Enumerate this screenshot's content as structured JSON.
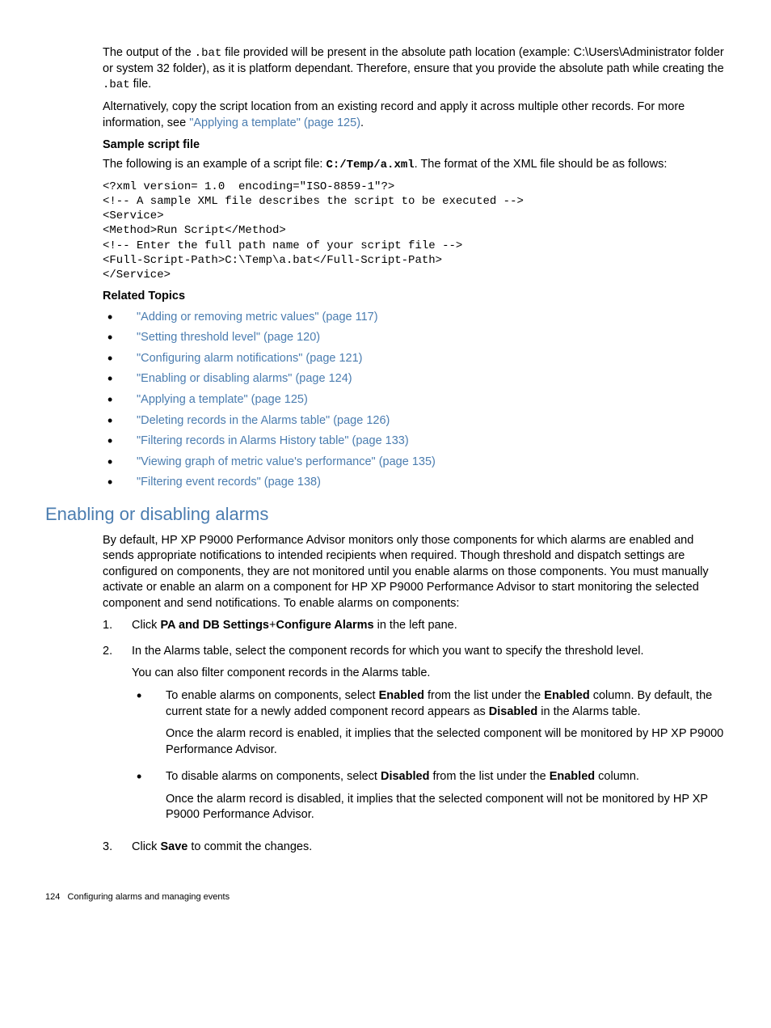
{
  "p1_a": "The output of the ",
  "p1_code1": ".bat",
  "p1_b": " file provided will be present in the absolute path location (example: C:\\Users\\Administrator folder or system 32 folder), as it is platform dependant. Therefore, ensure that you provide the absolute path while creating the ",
  "p1_code2": ".bat",
  "p1_c": " file.",
  "p2_a": "Alternatively, copy the script location from an existing record and apply it across multiple other records. For more information, see ",
  "p2_link": "\"Applying a template\" (page 125)",
  "p2_b": ".",
  "h_sample": "Sample script file",
  "p3_a": "The following is an example of a script file: ",
  "p3_code": "C:/Temp/a.xml",
  "p3_b": ". The format of the XML file should be as follows:",
  "codeblock": "<?xml version= 1.0  encoding=\"ISO-8859-1\"?>\n<!-- A sample XML file describes the script to be executed -->\n<Service>\n<Method>Run Script</Method>\n<!-- Enter the full path name of your script file -->\n<Full-Script-Path>C:\\Temp\\a.bat</Full-Script-Path>\n</Service>",
  "h_related": "Related Topics",
  "rel1": "\"Adding or removing metric values\" (page 117)",
  "rel2": "\"Setting threshold level\" (page 120)",
  "rel3": "\"Configuring alarm notifications\" (page 121)",
  "rel4": "\"Enabling or disabling alarms\" (page 124)",
  "rel5": "\"Applying a template\" (page 125)",
  "rel6": "\"Deleting records in the Alarms table\" (page 126)",
  "rel7": "\"Filtering records in Alarms History table\" (page 133)",
  "rel8": "\"Viewing graph of metric value's performance\" (page 135)",
  "rel9": "\"Filtering event records\" (page 138)",
  "h_section": "Enabling or disabling alarms",
  "p4": "By default, HP XP P9000 Performance Advisor monitors only those components for which alarms are enabled and sends appropriate notifications to intended recipients when required. Though threshold and dispatch settings are configured on components, they are not monitored until you enable alarms on those components. You must manually activate or enable an alarm on a component for HP XP P9000 Performance Advisor to start monitoring the selected component and send notifications. To enable alarms on components:",
  "step1_num": "1.",
  "step1_a": "Click ",
  "step1_b1": "PA and DB Settings",
  "step1_plus": "+",
  "step1_b2": "Configure Alarms",
  "step1_c": " in the left pane.",
  "step2_num": "2.",
  "step2_a": "In the Alarms table, select the component records for which you want to specify the threshold level.",
  "step2_b": "You can also filter component records in the Alarms table.",
  "sub1_a": "To enable alarms on components, select ",
  "sub1_b1": "Enabled",
  "sub1_c": " from the list under the ",
  "sub1_b2": "Enabled",
  "sub1_d": " column. By default, the current state for a newly added component record appears as ",
  "sub1_b3": "Disabled",
  "sub1_e": " in the Alarms table.",
  "sub1_f": "Once the alarm record is enabled, it implies that the selected component will be monitored by HP XP P9000 Performance Advisor.",
  "sub2_a": "To disable alarms on components, select ",
  "sub2_b1": "Disabled",
  "sub2_c": " from the list under the ",
  "sub2_b2": "Enabled",
  "sub2_d": " column.",
  "sub2_e": "Once the alarm record is disabled, it implies that the selected component will not be monitored by HP XP P9000 Performance Advisor.",
  "step3_num": "3.",
  "step3_a": "Click ",
  "step3_b": "Save",
  "step3_c": " to commit the changes.",
  "footer_page": "124",
  "footer_text": "Configuring alarms and managing events"
}
